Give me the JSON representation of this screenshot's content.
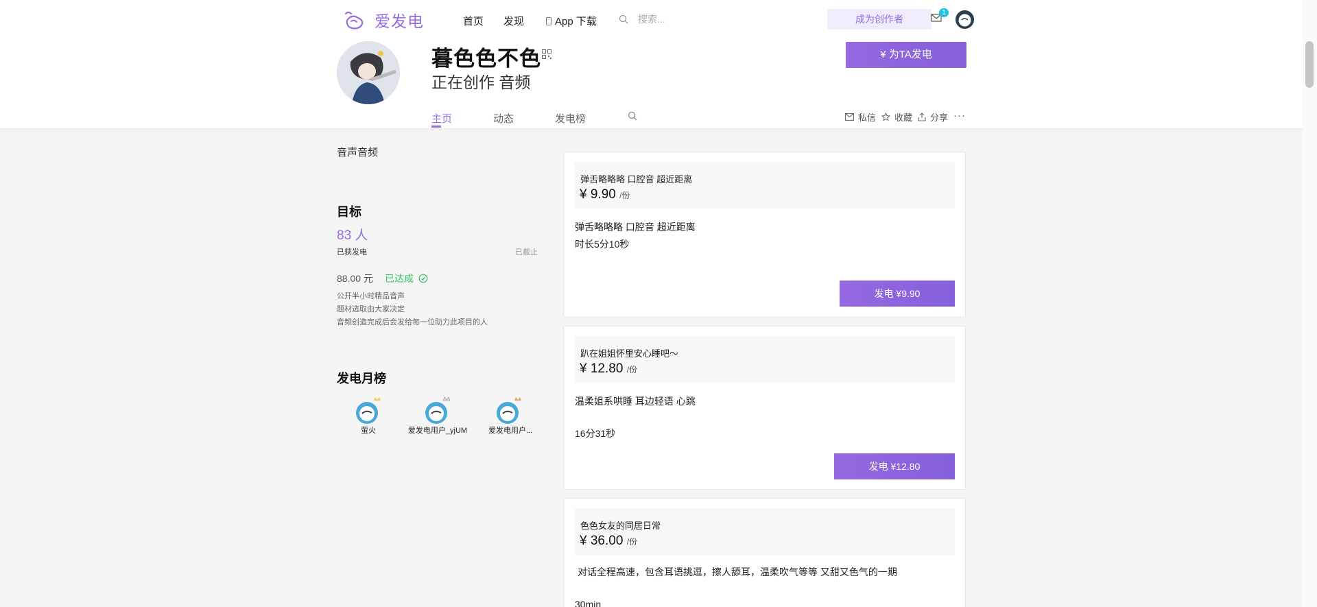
{
  "colors": {
    "brand": "#946ce6",
    "success": "#35c463",
    "badge": "#22c4e6"
  },
  "nav": {
    "logo_text": "爱发电",
    "links": [
      "首页",
      "发现",
      "App 下载"
    ],
    "search_placeholder": "搜索...",
    "become_creator": "成为创作者",
    "mail_badge": "1"
  },
  "profile": {
    "name": "暮色色不色",
    "subtitle": "正在创作 音频",
    "support_button": "¥ 为TA发电"
  },
  "tabs": [
    "主页",
    "动态",
    "发电榜"
  ],
  "actions": [
    "私信",
    "收藏",
    "分享"
  ],
  "sidebar": {
    "category": "音声音频",
    "goal_heading": "目标",
    "goal_count": "83 人",
    "goal_count_label": "已获发电",
    "goal_status": "已截止",
    "goal_amount": "88.00 元",
    "goal_done": "已达成",
    "goal_desc": [
      "公开半小时精品音声",
      "题材选取由大家决定",
      "音频创造完成后会发给每一位助力此项目的人"
    ],
    "rank_heading": "发电月榜",
    "rank_users": [
      "萤火",
      "爱发电用户_yjUM",
      "爱发电用户..."
    ]
  },
  "cards": [
    {
      "title": "弹舌略略略 口腔音 超近距离",
      "price": "¥ 9.90",
      "unit": "/份",
      "desc1": "弹舌略略略  口腔音  超近距离",
      "desc2": "时长5分10秒",
      "button": "发电  ¥9.90"
    },
    {
      "title": "趴在姐姐怀里安心睡吧～",
      "price": "¥ 12.80",
      "unit": "/份",
      "desc1": "温柔姐系哄睡 耳边轻语 心跳",
      "desc2": "16分31秒",
      "button": "发电  ¥12.80"
    },
    {
      "title": "色色女友的同居日常",
      "price": "¥ 36.00",
      "unit": "/份",
      "desc1": "对话全程高速，包含耳语挑逗，擦人舔耳，温柔吹气等等 又甜又色气的一期",
      "desc2": "30min"
    }
  ]
}
